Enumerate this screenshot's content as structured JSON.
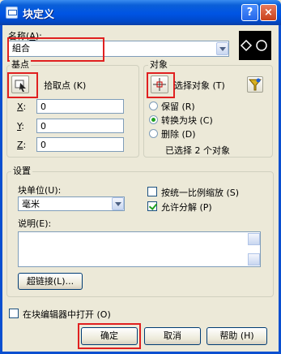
{
  "window": {
    "title": "块定义",
    "help_glyph": "?",
    "close_glyph": "×"
  },
  "name": {
    "label": "名称(",
    "label_key": "A",
    "label_end": "):",
    "value": "組合"
  },
  "base_point": {
    "group_title": "基点",
    "pick_label": "拾取点",
    "pick_key": "(K)",
    "x_label": "X",
    "y_label": "Y",
    "z_label": "Z",
    "axis_suffix": ":",
    "x_value": "0",
    "y_value": "0",
    "z_value": "0"
  },
  "objects": {
    "group_title": "对象",
    "select_label": "选择对象",
    "select_key": "(T)",
    "options": [
      {
        "label": "保留",
        "key": "(R)",
        "selected": false
      },
      {
        "label": "转换为块",
        "key": "(C)",
        "selected": true
      },
      {
        "label": "删除",
        "key": "(D)",
        "selected": false
      }
    ],
    "selected_count": "已选择 2 个对象"
  },
  "settings": {
    "group_title": "设置",
    "unit_label": "块单位",
    "unit_key": "(U):",
    "unit_value": "毫米",
    "uniform_scale_label": "按统一比例缩放",
    "uniform_scale_key": "(S)",
    "uniform_scale_checked": false,
    "explode_label": "允许分解",
    "explode_key": "(P)",
    "explode_checked": true,
    "description_label": "说明",
    "description_key": "(E):",
    "description_value": "",
    "hyperlink_label": "超链接",
    "hyperlink_key": "(L)..."
  },
  "open_in_editor": {
    "label": "在块编辑器中打开",
    "key": "(O)",
    "checked": false
  },
  "buttons": {
    "ok": "确定",
    "cancel": "取消",
    "help": "帮助",
    "help_key": "(H)"
  },
  "colors": {
    "title_bar": "#0054e3",
    "dialog_bg": "#ece9d8",
    "highlight": "#e02020"
  }
}
